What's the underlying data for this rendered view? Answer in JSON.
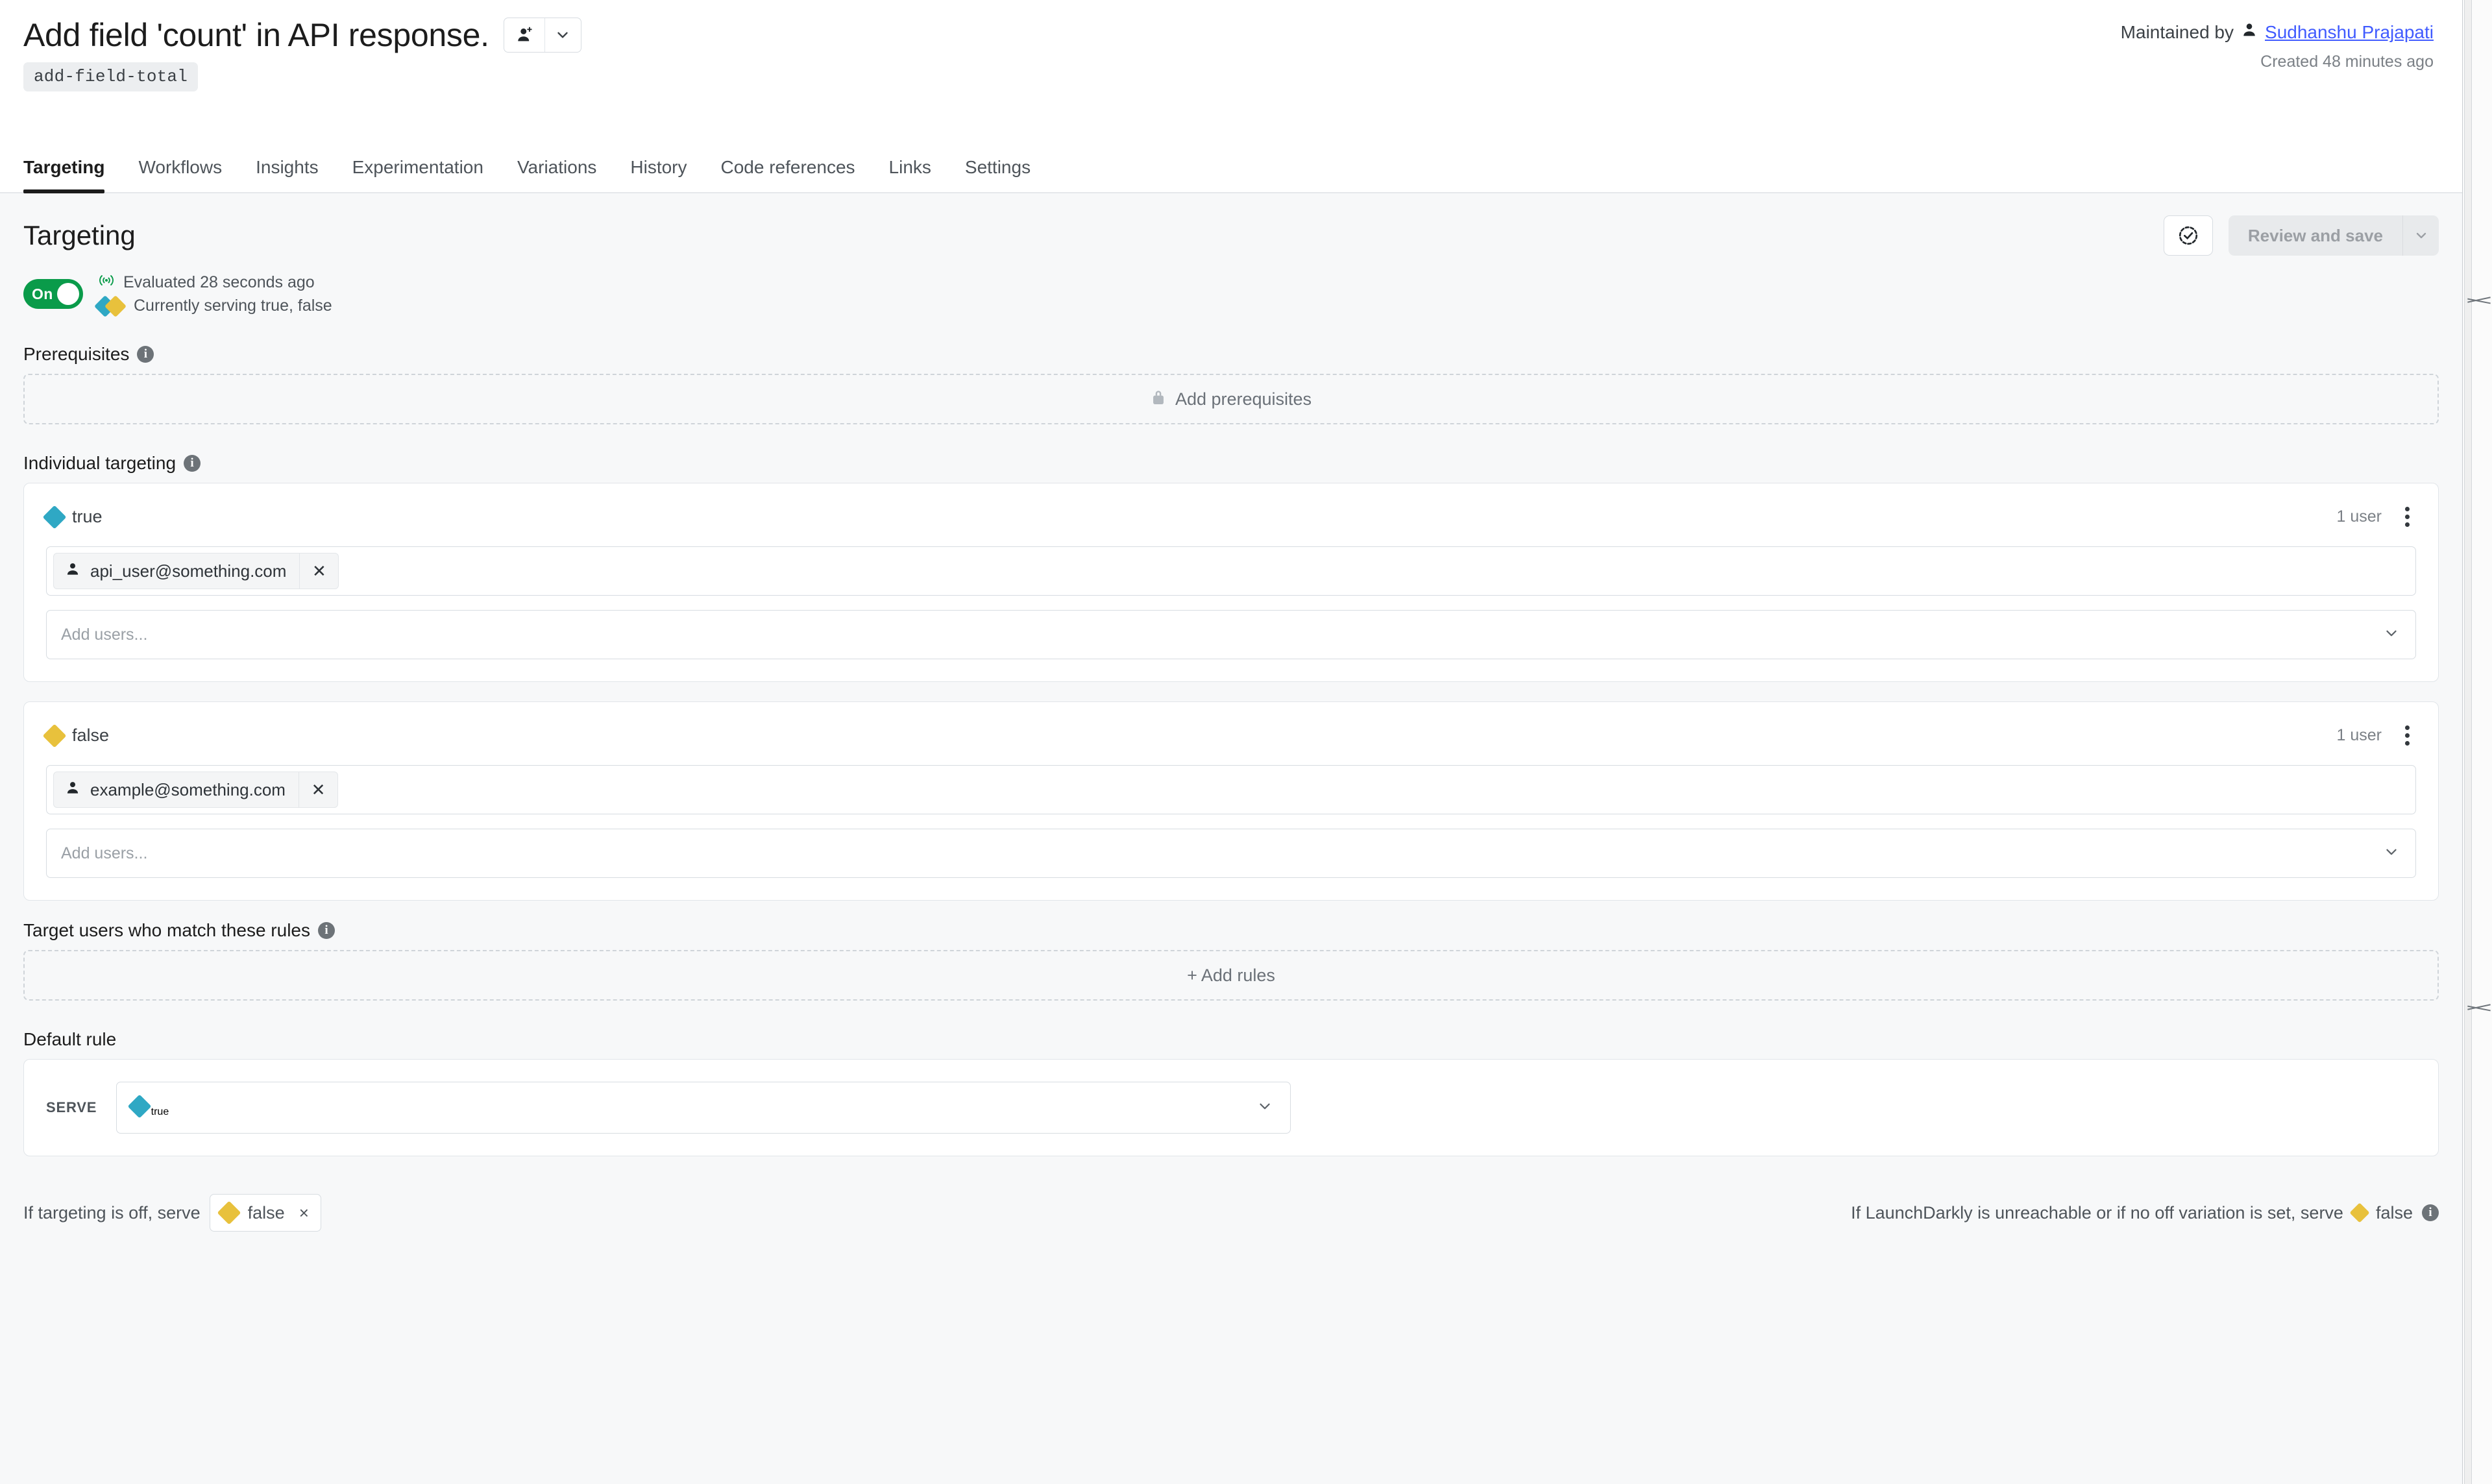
{
  "header": {
    "flag_title": "Add field 'count' in API response.",
    "flag_key": "add-field-total",
    "maintained_by_label": "Maintained by",
    "maintainer_name": "Sudhanshu Prajapati",
    "created_text": "Created 48 minutes ago",
    "add_maintainer_icon": "add-person-icon",
    "maintainer_caret_icon": "chevron-down-icon"
  },
  "tabs": [
    {
      "label": "Targeting",
      "active": true
    },
    {
      "label": "Workflows",
      "active": false
    },
    {
      "label": "Insights",
      "active": false
    },
    {
      "label": "Experimentation",
      "active": false
    },
    {
      "label": "Variations",
      "active": false
    },
    {
      "label": "History",
      "active": false
    },
    {
      "label": "Code references",
      "active": false
    },
    {
      "label": "Links",
      "active": false
    },
    {
      "label": "Settings",
      "active": false
    }
  ],
  "targeting": {
    "page_heading": "Targeting",
    "review_icon": "check-circle-dashed-icon",
    "review_button_label": "Review and save",
    "review_caret_icon": "chevron-down-icon",
    "toggle_label": "On",
    "toggle_on": true,
    "toggle_color": "#0a9b4a",
    "evaluated_text": "Evaluated 28 seconds ago",
    "evaluated_icon": "signal-broadcast-icon",
    "serving_text": "Currently serving true, false",
    "serving_icon": "dual-diamond-icon"
  },
  "prerequisites": {
    "label": "Prerequisites",
    "info_icon": "info-icon",
    "empty_action_label": "Add prerequisites",
    "empty_action_icon": "lock-icon"
  },
  "individual_targeting": {
    "label": "Individual targeting",
    "info_icon": "info-icon",
    "cards": [
      {
        "variation": "true",
        "variation_color": "#2fa8c4",
        "user_count": "1 user",
        "kebab_icon": "more-vertical-icon",
        "chips": [
          {
            "label": "api_user@something.com",
            "avatar_icon": "person-icon",
            "remove_icon": "close-icon"
          }
        ],
        "add_placeholder": "Add users...",
        "caret_icon": "chevron-down-icon"
      },
      {
        "variation": "false",
        "variation_color": "#e8c13c",
        "user_count": "1 user",
        "kebab_icon": "more-vertical-icon",
        "chips": [
          {
            "label": "example@something.com",
            "avatar_icon": "person-icon",
            "remove_icon": "close-icon"
          }
        ],
        "add_placeholder": "Add users...",
        "caret_icon": "chevron-down-icon"
      }
    ]
  },
  "rules": {
    "label": "Target users who match these rules",
    "info_icon": "info-icon",
    "empty_action_label": "+ Add rules"
  },
  "default_rule": {
    "label": "Default rule",
    "serve_label": "SERVE",
    "serve_value": "true",
    "serve_value_color": "#2fa8c4",
    "caret_icon": "chevron-down-icon"
  },
  "footer": {
    "off_prefix": "If targeting is off, serve",
    "off_variation": "false",
    "off_variation_color": "#e8c13c",
    "off_remove_icon": "close-icon",
    "fallback_text": "If LaunchDarkly is unreachable or if no off variation is set, serve",
    "fallback_variation": "false",
    "fallback_info_icon": "info-icon"
  }
}
